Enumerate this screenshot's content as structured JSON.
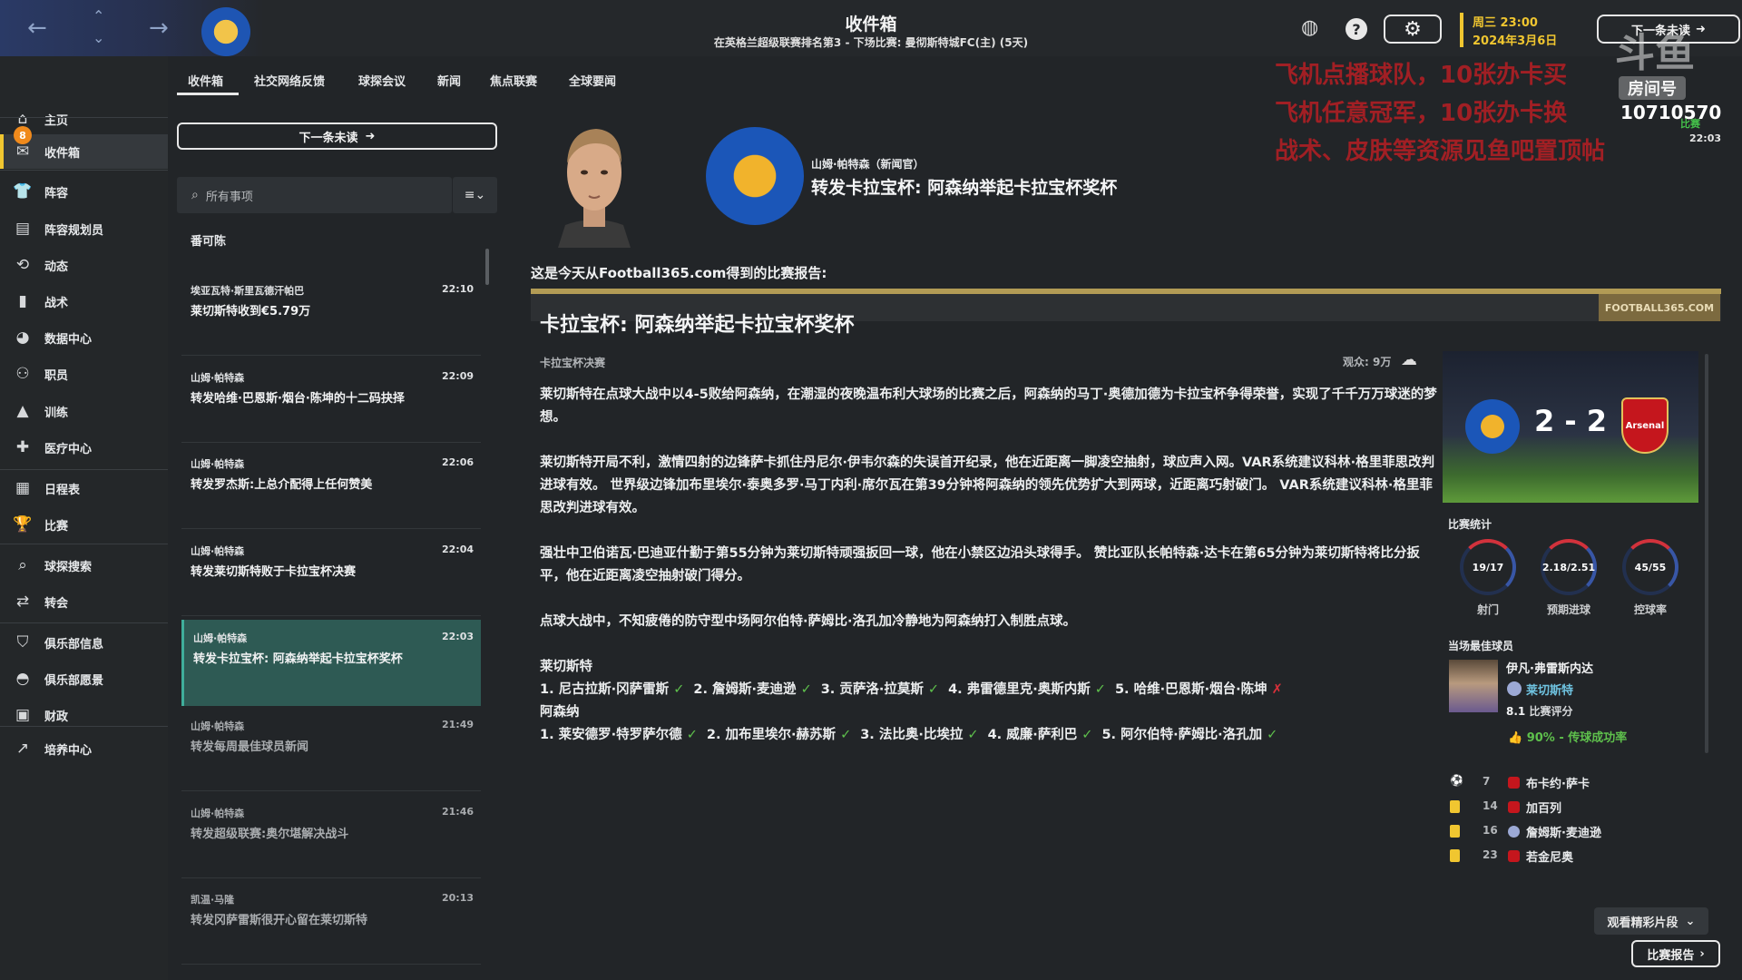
{
  "topbar": {
    "title": "收件箱",
    "subtitle": "在英格兰超级联赛排名第3 - 下场比赛: 曼彻斯特城FC(主) (5天)",
    "date_day": "周三 23:00",
    "date_date": "2024年3月6日",
    "next_unread": "下一条未读",
    "icons": [
      "back-arrow-icon",
      "forward-arrow-icon",
      "chevron-up-icon",
      "chevron-down-icon",
      "world-icon",
      "help-icon",
      "gear-icon"
    ]
  },
  "sidebar": {
    "badge": "8",
    "items": [
      {
        "label": "主页",
        "icon": "home-icon"
      },
      {
        "label": "收件箱",
        "icon": "inbox-icon"
      },
      {
        "label": "阵容",
        "icon": "squad-icon"
      },
      {
        "label": "阵容规划员",
        "icon": "planner-icon"
      },
      {
        "label": "动态",
        "icon": "dynamics-icon"
      },
      {
        "label": "战术",
        "icon": "tactics-icon"
      },
      {
        "label": "数据中心",
        "icon": "data-hub-icon"
      },
      {
        "label": "职员",
        "icon": "staff-icon"
      },
      {
        "label": "训练",
        "icon": "training-icon"
      },
      {
        "label": "医疗中心",
        "icon": "medical-icon"
      },
      {
        "label": "日程表",
        "icon": "schedule-icon"
      },
      {
        "label": "比赛",
        "icon": "trophy-icon"
      },
      {
        "label": "球探搜索",
        "icon": "search-icon"
      },
      {
        "label": "转会",
        "icon": "transfer-icon"
      },
      {
        "label": "俱乐部信息",
        "icon": "shield-icon"
      },
      {
        "label": "俱乐部愿景",
        "icon": "vision-icon"
      },
      {
        "label": "财政",
        "icon": "finance-icon"
      },
      {
        "label": "培养中心",
        "icon": "development-icon"
      }
    ]
  },
  "tabs": [
    "收件箱",
    "社交网络反馈",
    "球探会议",
    "新闻",
    "焦点联赛",
    "全球要闻"
  ],
  "list": {
    "next_unread": "下一条未读",
    "search_placeholder": "所有事项",
    "group_header": "番可陈",
    "messages": [
      {
        "sender": "埃亚瓦特·斯里瓦德汗帕巴",
        "time": "22:10",
        "subject": "莱切斯特收到€5.79万"
      },
      {
        "sender": "山姆·帕特森",
        "time": "22:09",
        "subject": "转发哈维·巴恩斯·烟台·陈坤的十二码抉择"
      },
      {
        "sender": "山姆·帕特森",
        "time": "22:06",
        "subject": "转发罗杰斯:上总介配得上任何赞美"
      },
      {
        "sender": "山姆·帕特森",
        "time": "22:04",
        "subject": "转发莱切斯特败于卡拉宝杯决赛"
      },
      {
        "sender": "山姆·帕特森",
        "time": "22:03",
        "subject": "转发卡拉宝杯: 阿森纳举起卡拉宝杯奖杯"
      },
      {
        "sender": "山姆·帕特森",
        "time": "21:49",
        "subject": "转发每周最佳球员新闻"
      },
      {
        "sender": "山姆·帕特森",
        "time": "21:46",
        "subject": "转发超级联赛:奥尔堪解决战斗"
      },
      {
        "sender": "凯温·马隆",
        "time": "20:13",
        "subject": "转发冈萨雷斯很开心留在莱切斯特"
      }
    ]
  },
  "message": {
    "sender": "山姆·帕特森（新闻官）",
    "title": "转发卡拉宝杯: 阿森纳举起卡拉宝杯奖杯",
    "intro": "这是今天从Football365.com得到的比赛报告:",
    "brand": "FOOTBALL365.COM"
  },
  "article": {
    "title": "卡拉宝杯: 阿森纳举起卡拉宝杯奖杯",
    "category": "卡拉宝杯决赛",
    "attendance": "观众: 9万",
    "paragraphs": [
      "莱切斯特在点球大战中以4-5败给阿森纳，在潮湿的夜晚温布利大球场的比赛之后，阿森纳的马丁·奥德加德为卡拉宝杯争得荣誉，实现了千千万万球迷的梦想。",
      "莱切斯特开局不利，激情四射的边锋萨卡抓住丹尼尔·伊韦尔森的失误首开纪录，他在近距离一脚凌空抽射，球应声入网。VAR系统建议科林·格里菲思改判进球有效。 世界级边锋加布里埃尔·泰奥多罗·马丁内利·席尔瓦在第39分钟将阿森纳的领先优势扩大到两球，近距离巧射破门。 VAR系统建议科林·格里菲思改判进球有效。",
      "强壮中卫伯诺瓦·巴迪亚什勤于第55分钟为莱切斯特顽强扳回一球，他在小禁区边沿头球得手。 赞比亚队长帕特森·达卡在第65分钟为莱切斯特将比分扳平，他在近距离凌空抽射破门得分。",
      "点球大战中，不知疲倦的防守型中场阿尔伯特·萨姆比·洛孔加冷静地为阿森纳打入制胜点球。"
    ],
    "home_team": "莱切斯特",
    "home_penalties": [
      {
        "text": "1. 尼古拉斯·冈萨雷斯",
        "scored": true
      },
      {
        "text": "2. 詹姆斯·麦迪逊",
        "scored": true
      },
      {
        "text": "3. 贡萨洛·拉莫斯",
        "scored": true
      },
      {
        "text": "4. 弗雷德里克·奥斯内斯",
        "scored": true
      },
      {
        "text": "5. 哈维·巴恩斯·烟台·陈坤",
        "scored": false
      }
    ],
    "away_team": "阿森纳",
    "away_penalties": [
      {
        "text": "1. 莱安德罗·特罗萨尔德",
        "scored": true
      },
      {
        "text": "2. 加布里埃尔·赫苏斯",
        "scored": true
      },
      {
        "text": "3. 法比奥·比埃拉",
        "scored": true
      },
      {
        "text": "4. 威廉·萨利巴",
        "scored": true
      },
      {
        "text": "5. 阿尔伯特·萨姆比·洛孔加",
        "scored": true
      }
    ]
  },
  "match": {
    "score": "2 - 2",
    "away_crest_text": "Arsenal",
    "stats_title": "比赛统计",
    "stats": [
      {
        "value": "19/17",
        "label": "射门"
      },
      {
        "value": "2.18/2.51",
        "label": "预期进球"
      },
      {
        "value": "45/55",
        "label": "控球率"
      }
    ],
    "motm_title": "当场最佳球员",
    "motm_name": "伊凡·弗雷斯内达",
    "motm_club": "莱切斯特",
    "motm_rating": "8.1",
    "motm_rating_label": "比赛评分",
    "motm_pass": "90% - 传球成功率",
    "events": [
      {
        "type": "goal",
        "minute": "7",
        "club": "away",
        "player": "布卡约·萨卡"
      },
      {
        "type": "yellow-card",
        "minute": "14",
        "club": "away",
        "player": "加百列"
      },
      {
        "type": "yellow-card",
        "minute": "16",
        "club": "home",
        "player": "詹姆斯·麦迪逊"
      },
      {
        "type": "yellow-card",
        "minute": "23",
        "club": "away",
        "player": "若金尼奥"
      }
    ],
    "highlights": "观看精彩片段",
    "report": "比赛报告"
  },
  "overlay": {
    "lines": [
      "飞机点播球队，10张办卡买",
      "飞机任意冠军，10张办卡换",
      "战术、皮肤等资源见鱼吧置顶帖"
    ],
    "logo": "斗鱼",
    "room_label": "房间号",
    "room_number": "10710570",
    "live_label": "比赛",
    "clock": "22:03"
  },
  "colors": {
    "accent": "#f0c630",
    "selected_row": "#2e5a54",
    "tick": "#5ec04c",
    "miss": "#d8303a"
  }
}
